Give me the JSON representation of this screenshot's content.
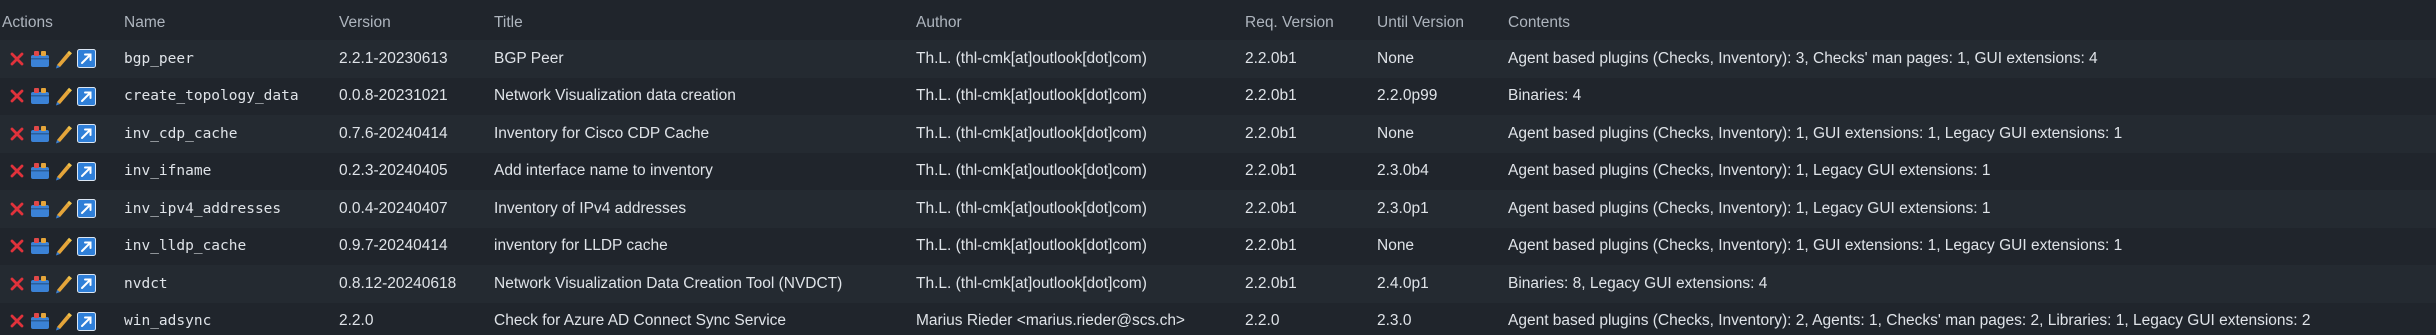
{
  "columns": {
    "actions": "Actions",
    "name": "Name",
    "version": "Version",
    "title": "Title",
    "author": "Author",
    "req_version": "Req. Version",
    "until_version": "Until Version",
    "contents": "Contents"
  },
  "action_icons": [
    "delete-icon",
    "package-icon",
    "edit-icon",
    "download-icon"
  ],
  "colors": {
    "background": "#20252c",
    "row_alt": "#242a31",
    "delete": "#e0323b",
    "package": "#3b82d6",
    "edit": "#e5a53a",
    "download": "#2f7fd8"
  },
  "rows": [
    {
      "name": "bgp_peer",
      "version": "2.2.1-20230613",
      "title": "BGP Peer",
      "author": "Th.L. (thl-cmk[at]outlook[dot]com)",
      "req": "2.2.0b1",
      "until": "None",
      "contents": "Agent based plugins (Checks, Inventory): 3, Checks' man pages: 1, GUI extensions: 4"
    },
    {
      "name": "create_topology_data",
      "version": "0.0.8-20231021",
      "title": "Network Visualization data creation",
      "author": "Th.L. (thl-cmk[at]outlook[dot]com)",
      "req": "2.2.0b1",
      "until": "2.2.0p99",
      "contents": "Binaries: 4"
    },
    {
      "name": "inv_cdp_cache",
      "version": "0.7.6-20240414",
      "title": "Inventory for Cisco CDP Cache",
      "author": "Th.L. (thl-cmk[at]outlook[dot]com)",
      "req": "2.2.0b1",
      "until": "None",
      "contents": "Agent based plugins (Checks, Inventory): 1, GUI extensions: 1, Legacy GUI extensions: 1"
    },
    {
      "name": "inv_ifname",
      "version": "0.2.3-20240405",
      "title": "Add interface name to inventory",
      "author": "Th.L. (thl-cmk[at]outlook[dot]com)",
      "req": "2.2.0b1",
      "until": "2.3.0b4",
      "contents": "Agent based plugins (Checks, Inventory): 1, Legacy GUI extensions: 1"
    },
    {
      "name": "inv_ipv4_addresses",
      "version": "0.0.4-20240407",
      "title": "Inventory of IPv4 addresses",
      "author": "Th.L. (thl-cmk[at]outlook[dot]com)",
      "req": "2.2.0b1",
      "until": "2.3.0p1",
      "contents": "Agent based plugins (Checks, Inventory): 1, Legacy GUI extensions: 1"
    },
    {
      "name": "inv_lldp_cache",
      "version": "0.9.7-20240414",
      "title": "inventory for LLDP cache",
      "author": "Th.L. (thl-cmk[at]outlook[dot]com)",
      "req": "2.2.0b1",
      "until": "None",
      "contents": "Agent based plugins (Checks, Inventory): 1, GUI extensions: 1, Legacy GUI extensions: 1"
    },
    {
      "name": "nvdct",
      "version": "0.8.12-20240618",
      "title": "Network Visualization Data Creation Tool (NVDCT)",
      "author": "Th.L. (thl-cmk[at]outlook[dot]com)",
      "req": "2.2.0b1",
      "until": "2.4.0p1",
      "contents": "Binaries: 8, Legacy GUI extensions: 4"
    },
    {
      "name": "win_adsync",
      "version": "2.2.0",
      "title": "Check for Azure AD Connect Sync Service",
      "author": "Marius Rieder <marius.rieder@scs.ch>",
      "req": "2.2.0",
      "until": "2.3.0",
      "contents": "Agent based plugins (Checks, Inventory): 2, Agents: 1, Checks' man pages: 2, Libraries: 1, Legacy GUI extensions: 2"
    }
  ]
}
